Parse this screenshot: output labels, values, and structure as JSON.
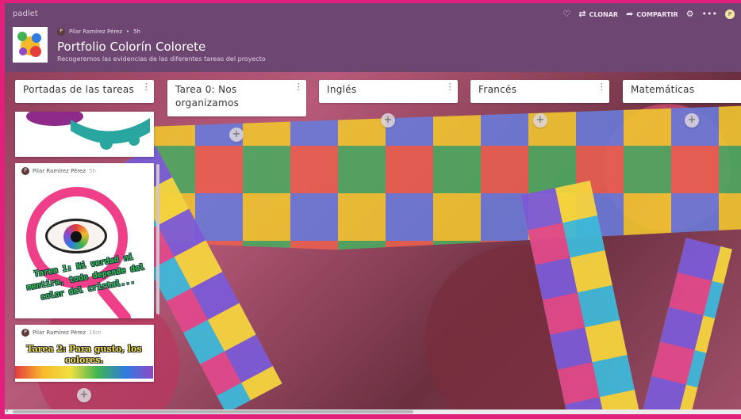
{
  "app": {
    "brand": "padlet"
  },
  "header": {
    "clone_label": "CLONAR",
    "share_label": "COMPARTIR",
    "user_initial": "P",
    "icons": [
      "heart-icon",
      "clone-icon",
      "share-icon",
      "gear-icon",
      "more-icon"
    ]
  },
  "padlet": {
    "author": "Pilar Ramírez Pérez",
    "author_initial": "P",
    "separator": "•",
    "time": "5h",
    "title": "Portfolio Colorín Colorete",
    "description": "Recogeremos las evidencias de las diferentes tareas del proyecto"
  },
  "columns": [
    {
      "title": "Portadas de las tareas"
    },
    {
      "title": "Tarea 0: Nos organizamos"
    },
    {
      "title": "Inglés"
    },
    {
      "title": "Francés"
    },
    {
      "title": "Matemáticas"
    }
  ],
  "posts": [
    {
      "author": "Pilar Ramírez Pérez",
      "time": "5h",
      "image_text": "Tarea 1: Ni verdad ni mentira, todo depende del color del cristal..."
    },
    {
      "author": "Pilar Ramírez Pérez",
      "time": "16m",
      "image_text": "Tarea 2: Para gusto, los colores."
    }
  ],
  "colors": {
    "header_bg": "#6e4672",
    "frame": "#e0207a",
    "card": "#ffffff"
  }
}
